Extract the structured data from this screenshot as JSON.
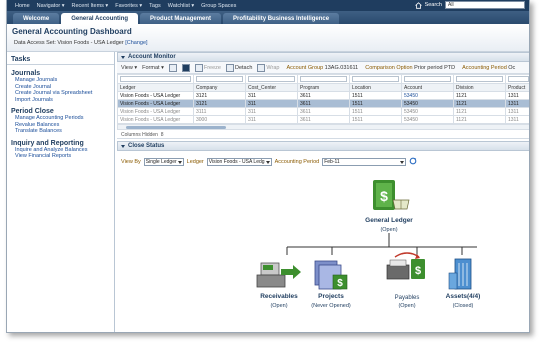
{
  "topnav": {
    "items": [
      "Home",
      "Navigator ▾",
      "Recent Items ▾",
      "Favorites ▾",
      "Tags",
      "Watchlist ▾",
      "Group Spaces"
    ],
    "search_label": "Search",
    "search_value": "All"
  },
  "tabs": [
    "Welcome",
    "General Accounting",
    "Product Management",
    "Profitability Business Intelligence"
  ],
  "header": {
    "title": "General Accounting Dashboard",
    "access_prefix": "Data Access Set:",
    "access_value": "Vision Foods - USA Ledger",
    "change_link": "[Change]"
  },
  "tasks": {
    "title": "Tasks",
    "groups": [
      {
        "name": "Journals",
        "links": [
          "Manage Journals",
          "Create Journal",
          "Create Journal via Spreadsheet",
          "Import Journals"
        ]
      },
      {
        "name": "Period Close",
        "links": [
          "Manage Accounting Periods",
          "Revalue Balances",
          "Translate Balances"
        ]
      },
      {
        "name": "Inquiry and Reporting",
        "links": [
          "Inquire and Analyze Balances",
          "View Financial Reports"
        ]
      }
    ]
  },
  "account_monitor": {
    "title": "Account Monitor",
    "toolbar": {
      "view": "View ▾",
      "format": "Format ▾",
      "freeze": "Freeze",
      "detach": "Detach",
      "wrap": "Wrap",
      "account_group_label": "Account Group",
      "account_group_value": "13AG.031611",
      "comparison_label": "Comparison Option",
      "comparison_value": "Prior period PTD",
      "period_label": "Accounting Period",
      "period_value": "Oc"
    },
    "columns": [
      "Ledger",
      "Company",
      "Cost_Center",
      "Program",
      "Location",
      "Account",
      "Division",
      "Product"
    ],
    "rows": [
      [
        "Vision Foods - USA Ledger",
        "3121",
        "311",
        "3611",
        "1511",
        "53450",
        "1121",
        "1311"
      ],
      [
        "Vision Foods - USA Ledger",
        "3121",
        "311",
        "3611",
        "1511",
        "53450",
        "1121",
        "1311"
      ],
      [
        "Vision Foods - USA Ledger",
        "3111",
        "311",
        "3611",
        "1511",
        "53450",
        "1121",
        "1311"
      ],
      [
        "Vision Foods - USA Ledger",
        "3000",
        "311",
        "3611",
        "1511",
        "53450",
        "1121",
        "1311"
      ]
    ],
    "hidden_cols_label": "Columns Hidden",
    "hidden_cols_value": "8"
  },
  "close_status": {
    "title": "Close Status",
    "view_by_label": "View By",
    "view_by_value": "Single Ledger",
    "ledger_label": "Ledger",
    "ledger_value": "Vision Foods - USA Ledg",
    "period_label": "Accounting Period",
    "period_value": "Feb-11",
    "nodes": {
      "general_ledger": {
        "name": "General Ledger",
        "status": "(Open)"
      },
      "receivables": {
        "name": "Receivables",
        "status": "(Open)"
      },
      "projects": {
        "name": "Projects",
        "status": "(Never Opened)"
      },
      "payables": {
        "name": "Payables",
        "status": "(Open)"
      },
      "assets": {
        "name": "Assets(4/4)",
        "status": "(Closed)"
      }
    }
  },
  "colors": {
    "nav_dark": "#1f3d5f",
    "link_blue": "#1a4d99",
    "accent_green": "#3d8f2e",
    "selection": "#a9bdd4"
  }
}
